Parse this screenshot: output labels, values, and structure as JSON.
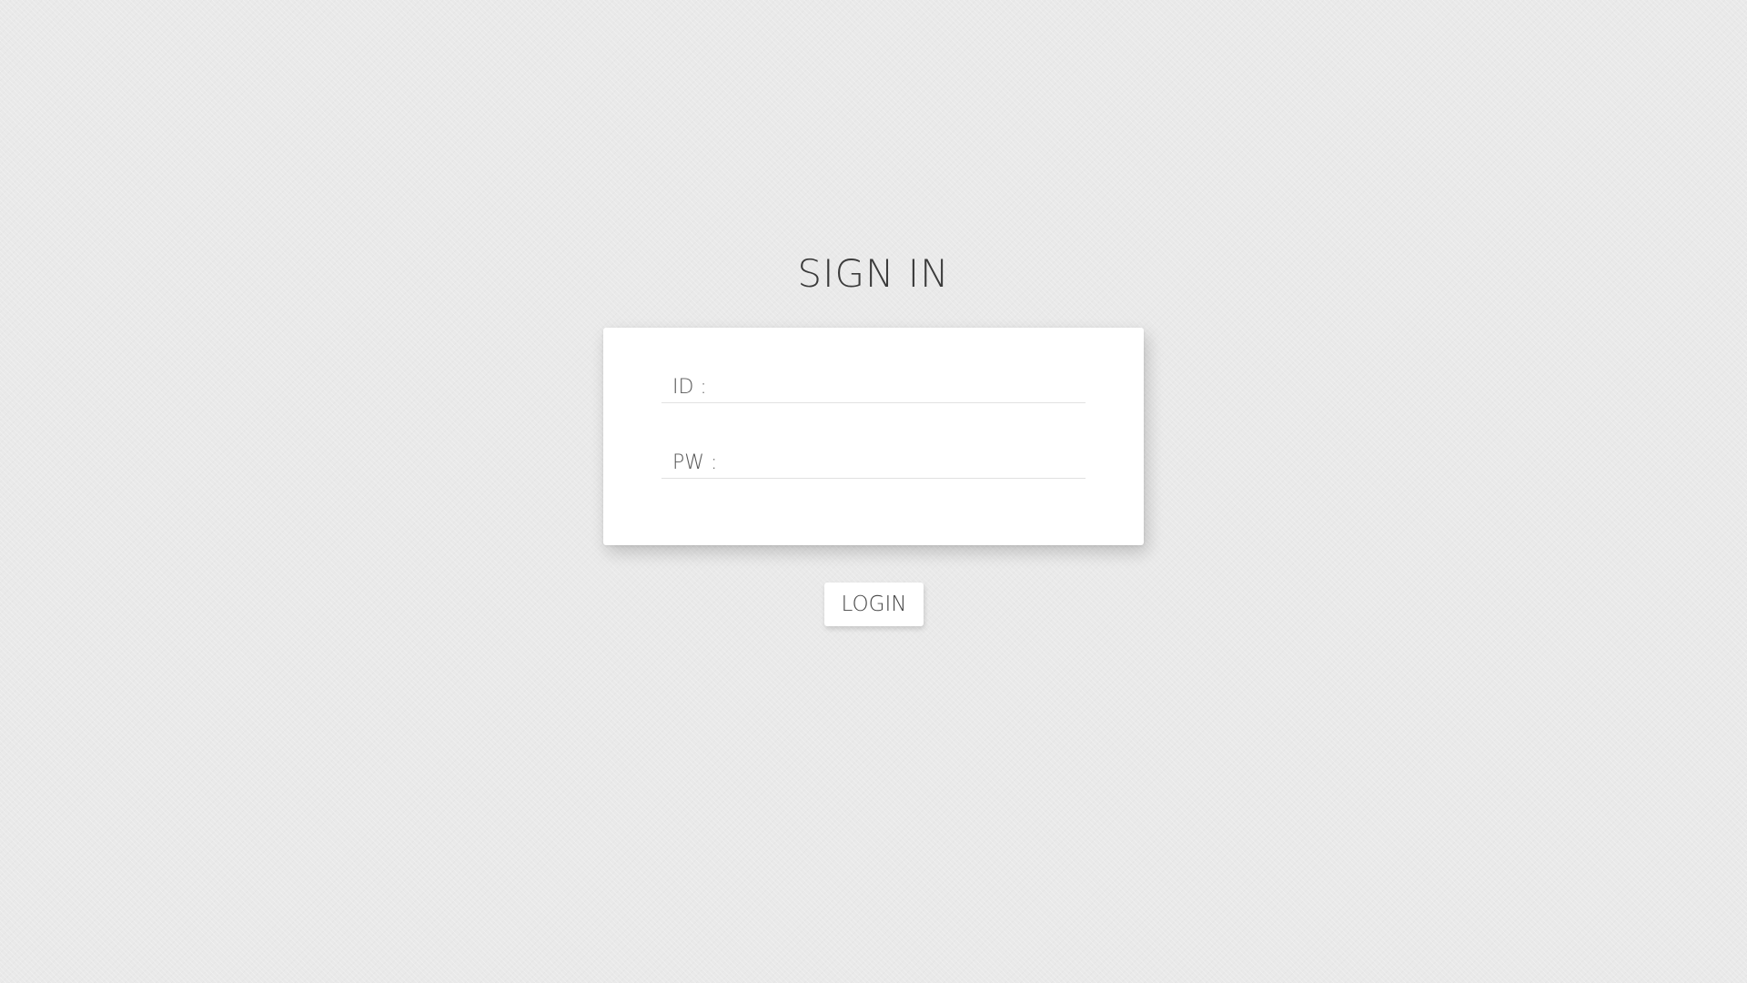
{
  "page": {
    "title": "SIGN IN"
  },
  "form": {
    "id_label": "ID :",
    "id_value": "",
    "pw_label": "PW :",
    "pw_value": ""
  },
  "actions": {
    "login_label": "LOGIN"
  },
  "colors": {
    "background": "#e9e9e9",
    "card": "#ffffff",
    "text": "#3b3b3b"
  }
}
